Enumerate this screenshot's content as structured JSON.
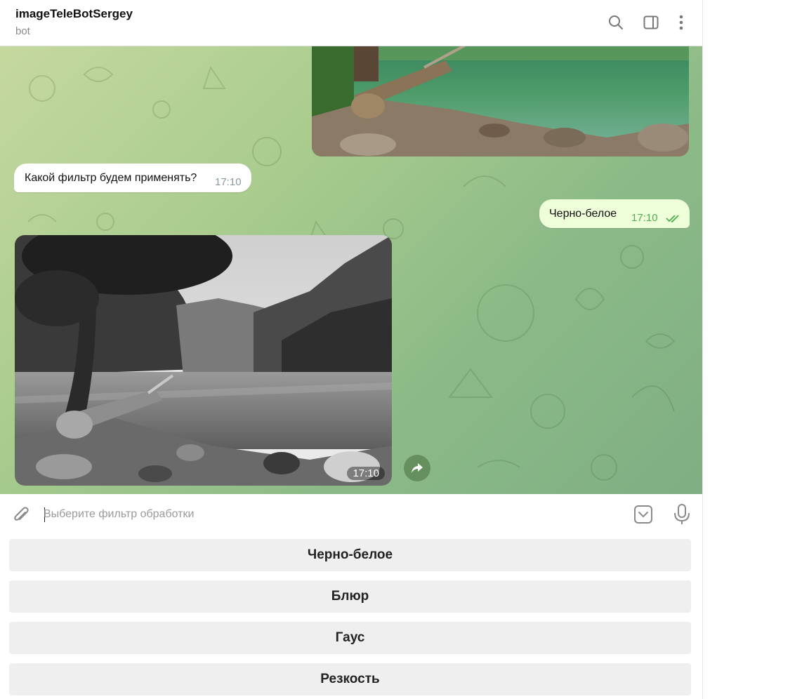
{
  "header": {
    "title": "imageTeleBotSergey",
    "subtitle": "bot"
  },
  "icons": {
    "search": "search-icon",
    "sidebar": "sidebar-toggle-icon",
    "more": "more-vertical-icon",
    "attach": "paperclip-icon",
    "keyboard": "bot-keyboard-icon",
    "mic": "microphone-icon",
    "share": "share-arrow-icon",
    "read": "double-check-icon"
  },
  "messages": [
    {
      "type": "photo",
      "direction": "in",
      "style": "color"
    },
    {
      "type": "text",
      "direction": "in",
      "text": "Какой фильтр будем применять?",
      "time": "17:10"
    },
    {
      "type": "text",
      "direction": "out",
      "text": "Черно-белое",
      "time": "17:10",
      "status": "read"
    },
    {
      "type": "photo",
      "direction": "in",
      "style": "grayscale",
      "time": "17:10"
    }
  ],
  "composer": {
    "placeholder": "Выберите фильтр обработки",
    "value": ""
  },
  "keyboard_buttons": [
    {
      "label": "Черно-белое"
    },
    {
      "label": "Блюр"
    },
    {
      "label": "Гаус"
    },
    {
      "label": "Резкость"
    }
  ],
  "colors": {
    "chat_bg": "#a9cc8e",
    "out_bubble": "#eefed9",
    "in_bubble": "#ffffff",
    "read_check": "#4fae4e",
    "keyboard_button": "#efefef"
  }
}
